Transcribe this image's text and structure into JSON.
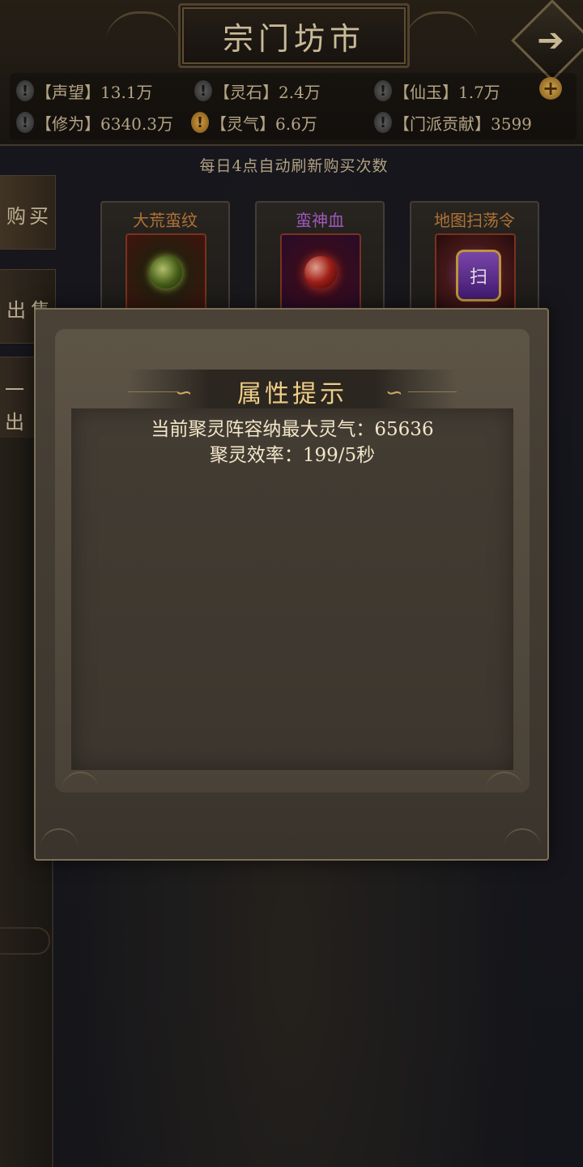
{
  "header": {
    "title": "宗门坊市",
    "back_icon": "➔"
  },
  "resources": [
    {
      "label": "【声望】13.1万",
      "warn": "!",
      "warn_color": "gray"
    },
    {
      "label": "【灵石】2.4万",
      "warn": "!",
      "warn_color": "gray"
    },
    {
      "label": "【仙玉】1.7万",
      "warn": "!",
      "warn_color": "gray"
    },
    {
      "label": "【修为】6340.3万",
      "warn": "!",
      "warn_color": "gray"
    },
    {
      "label": "【灵气】6.6万",
      "warn": "!",
      "warn_color": "gold"
    },
    {
      "label": "【门派贡献】3599",
      "warn": "!",
      "warn_color": "gray"
    }
  ],
  "plus_label": "+",
  "refresh_note": "每日4点自动刷新购买次数",
  "tabs": {
    "buy": "购买",
    "sell": "出售",
    "bulk_line1": "一",
    "bulk_line2": "出"
  },
  "shop_items": [
    {
      "name": "大荒蛮纹",
      "name_color": "#c8823c"
    },
    {
      "name": "蛮神血",
      "name_color": "#b763d6"
    },
    {
      "name": "地图扫荡令",
      "name_color": "#c8823c",
      "icon_char": "扫"
    }
  ],
  "modal": {
    "title": "属性提示",
    "line1": "当前聚灵阵容纳最大灵气：65636",
    "line2": "聚灵效率：199/5秒",
    "swirl": "∽"
  }
}
